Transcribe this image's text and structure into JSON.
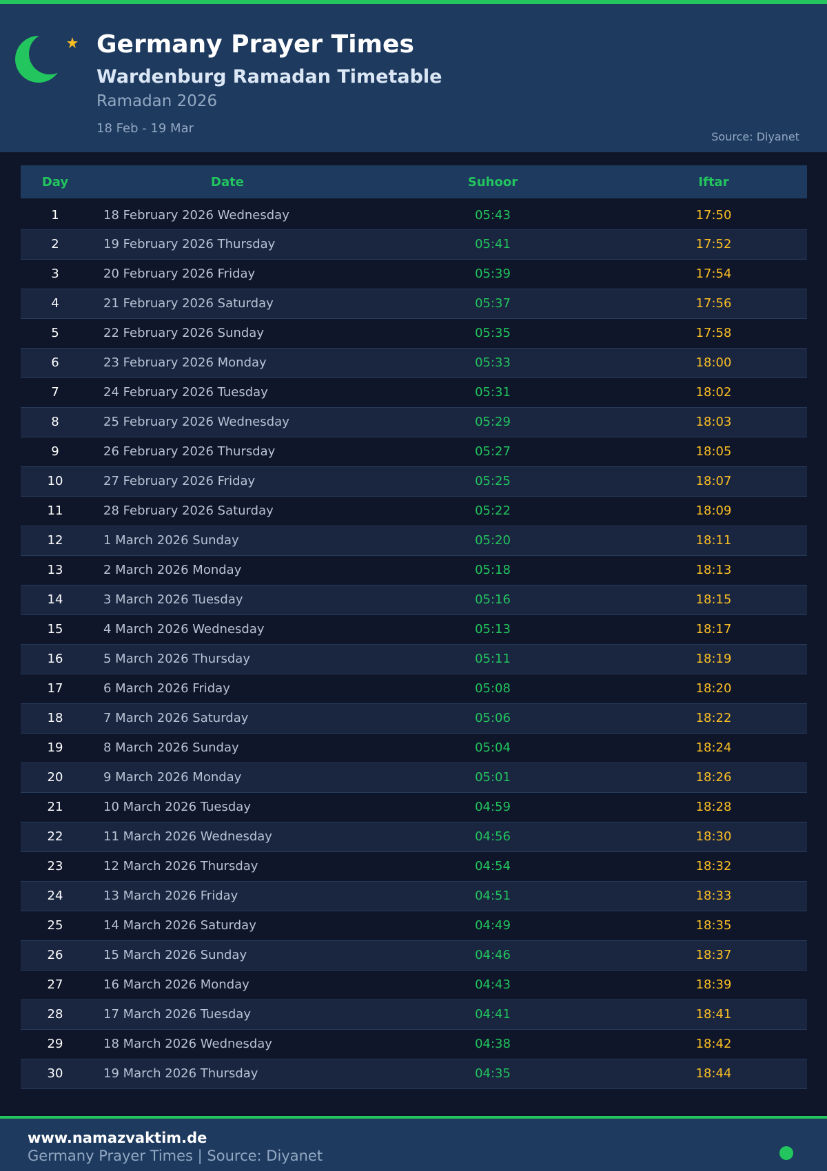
{
  "header": {
    "title": "Germany Prayer Times",
    "subtitle": "Wardenburg Ramadan Timetable",
    "year": "Ramadan 2026",
    "range": "18 Feb - 19 Mar",
    "source": "Source: Diyanet",
    "logo_icon": "crescent-star-icon"
  },
  "table": {
    "columns": [
      "Day",
      "Date",
      "Suhoor",
      "Iftar"
    ],
    "rows": [
      {
        "day": "1",
        "date": "18 February 2026 Wednesday",
        "suhoor": "05:43",
        "iftar": "17:50"
      },
      {
        "day": "2",
        "date": "19 February 2026 Thursday",
        "suhoor": "05:41",
        "iftar": "17:52"
      },
      {
        "day": "3",
        "date": "20 February 2026 Friday",
        "suhoor": "05:39",
        "iftar": "17:54"
      },
      {
        "day": "4",
        "date": "21 February 2026 Saturday",
        "suhoor": "05:37",
        "iftar": "17:56"
      },
      {
        "day": "5",
        "date": "22 February 2026 Sunday",
        "suhoor": "05:35",
        "iftar": "17:58"
      },
      {
        "day": "6",
        "date": "23 February 2026 Monday",
        "suhoor": "05:33",
        "iftar": "18:00"
      },
      {
        "day": "7",
        "date": "24 February 2026 Tuesday",
        "suhoor": "05:31",
        "iftar": "18:02"
      },
      {
        "day": "8",
        "date": "25 February 2026 Wednesday",
        "suhoor": "05:29",
        "iftar": "18:03"
      },
      {
        "day": "9",
        "date": "26 February 2026 Thursday",
        "suhoor": "05:27",
        "iftar": "18:05"
      },
      {
        "day": "10",
        "date": "27 February 2026 Friday",
        "suhoor": "05:25",
        "iftar": "18:07"
      },
      {
        "day": "11",
        "date": "28 February 2026 Saturday",
        "suhoor": "05:22",
        "iftar": "18:09"
      },
      {
        "day": "12",
        "date": "1 March 2026 Sunday",
        "suhoor": "05:20",
        "iftar": "18:11"
      },
      {
        "day": "13",
        "date": "2 March 2026 Monday",
        "suhoor": "05:18",
        "iftar": "18:13"
      },
      {
        "day": "14",
        "date": "3 March 2026 Tuesday",
        "suhoor": "05:16",
        "iftar": "18:15"
      },
      {
        "day": "15",
        "date": "4 March 2026 Wednesday",
        "suhoor": "05:13",
        "iftar": "18:17"
      },
      {
        "day": "16",
        "date": "5 March 2026 Thursday",
        "suhoor": "05:11",
        "iftar": "18:19"
      },
      {
        "day": "17",
        "date": "6 March 2026 Friday",
        "suhoor": "05:08",
        "iftar": "18:20"
      },
      {
        "day": "18",
        "date": "7 March 2026 Saturday",
        "suhoor": "05:06",
        "iftar": "18:22"
      },
      {
        "day": "19",
        "date": "8 March 2026 Sunday",
        "suhoor": "05:04",
        "iftar": "18:24"
      },
      {
        "day": "20",
        "date": "9 March 2026 Monday",
        "suhoor": "05:01",
        "iftar": "18:26"
      },
      {
        "day": "21",
        "date": "10 March 2026 Tuesday",
        "suhoor": "04:59",
        "iftar": "18:28"
      },
      {
        "day": "22",
        "date": "11 March 2026 Wednesday",
        "suhoor": "04:56",
        "iftar": "18:30"
      },
      {
        "day": "23",
        "date": "12 March 2026 Thursday",
        "suhoor": "04:54",
        "iftar": "18:32"
      },
      {
        "day": "24",
        "date": "13 March 2026 Friday",
        "suhoor": "04:51",
        "iftar": "18:33"
      },
      {
        "day": "25",
        "date": "14 March 2026 Saturday",
        "suhoor": "04:49",
        "iftar": "18:35"
      },
      {
        "day": "26",
        "date": "15 March 2026 Sunday",
        "suhoor": "04:46",
        "iftar": "18:37"
      },
      {
        "day": "27",
        "date": "16 March 2026 Monday",
        "suhoor": "04:43",
        "iftar": "18:39"
      },
      {
        "day": "28",
        "date": "17 March 2026 Tuesday",
        "suhoor": "04:41",
        "iftar": "18:41"
      },
      {
        "day": "29",
        "date": "18 March 2026 Wednesday",
        "suhoor": "04:38",
        "iftar": "18:42"
      },
      {
        "day": "30",
        "date": "19 March 2026 Thursday",
        "suhoor": "04:35",
        "iftar": "18:44"
      }
    ]
  },
  "footer": {
    "site": "www.namazvaktim.de",
    "text": "Germany Prayer Times | Source: Diyanet"
  },
  "colors": {
    "accent_green": "#22c55e",
    "iftar_gold": "#fbbf24",
    "header_bg": "#1e3a5f",
    "page_bg": "#0f1629"
  }
}
